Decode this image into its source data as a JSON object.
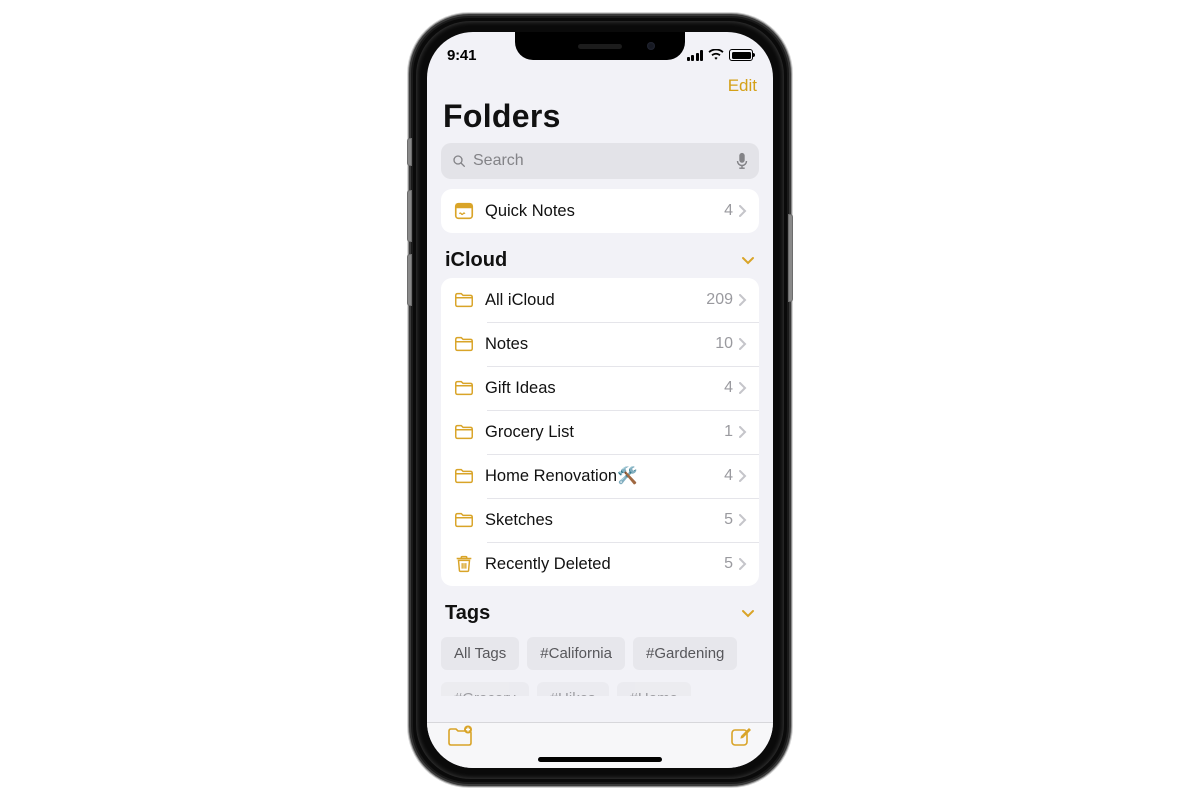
{
  "status": {
    "time": "9:41"
  },
  "nav": {
    "edit": "Edit"
  },
  "title": "Folders",
  "search": {
    "placeholder": "Search"
  },
  "quick": {
    "label": "Quick Notes",
    "count": "4"
  },
  "icloud": {
    "header": "iCloud",
    "items": [
      {
        "label": "All iCloud",
        "count": "209",
        "icon": "folder"
      },
      {
        "label": "Notes",
        "count": "10",
        "icon": "folder"
      },
      {
        "label": "Gift Ideas",
        "count": "4",
        "icon": "folder"
      },
      {
        "label": "Grocery List",
        "count": "1",
        "icon": "folder"
      },
      {
        "label": "Home Renovation🛠️",
        "count": "4",
        "icon": "folder"
      },
      {
        "label": "Sketches",
        "count": "5",
        "icon": "folder"
      },
      {
        "label": "Recently Deleted",
        "count": "5",
        "icon": "trash"
      }
    ]
  },
  "tags": {
    "header": "Tags",
    "row1": [
      "All Tags",
      "#California",
      "#Gardening"
    ],
    "row2": [
      "#Grocery",
      "#Hikes",
      "#Home"
    ]
  }
}
